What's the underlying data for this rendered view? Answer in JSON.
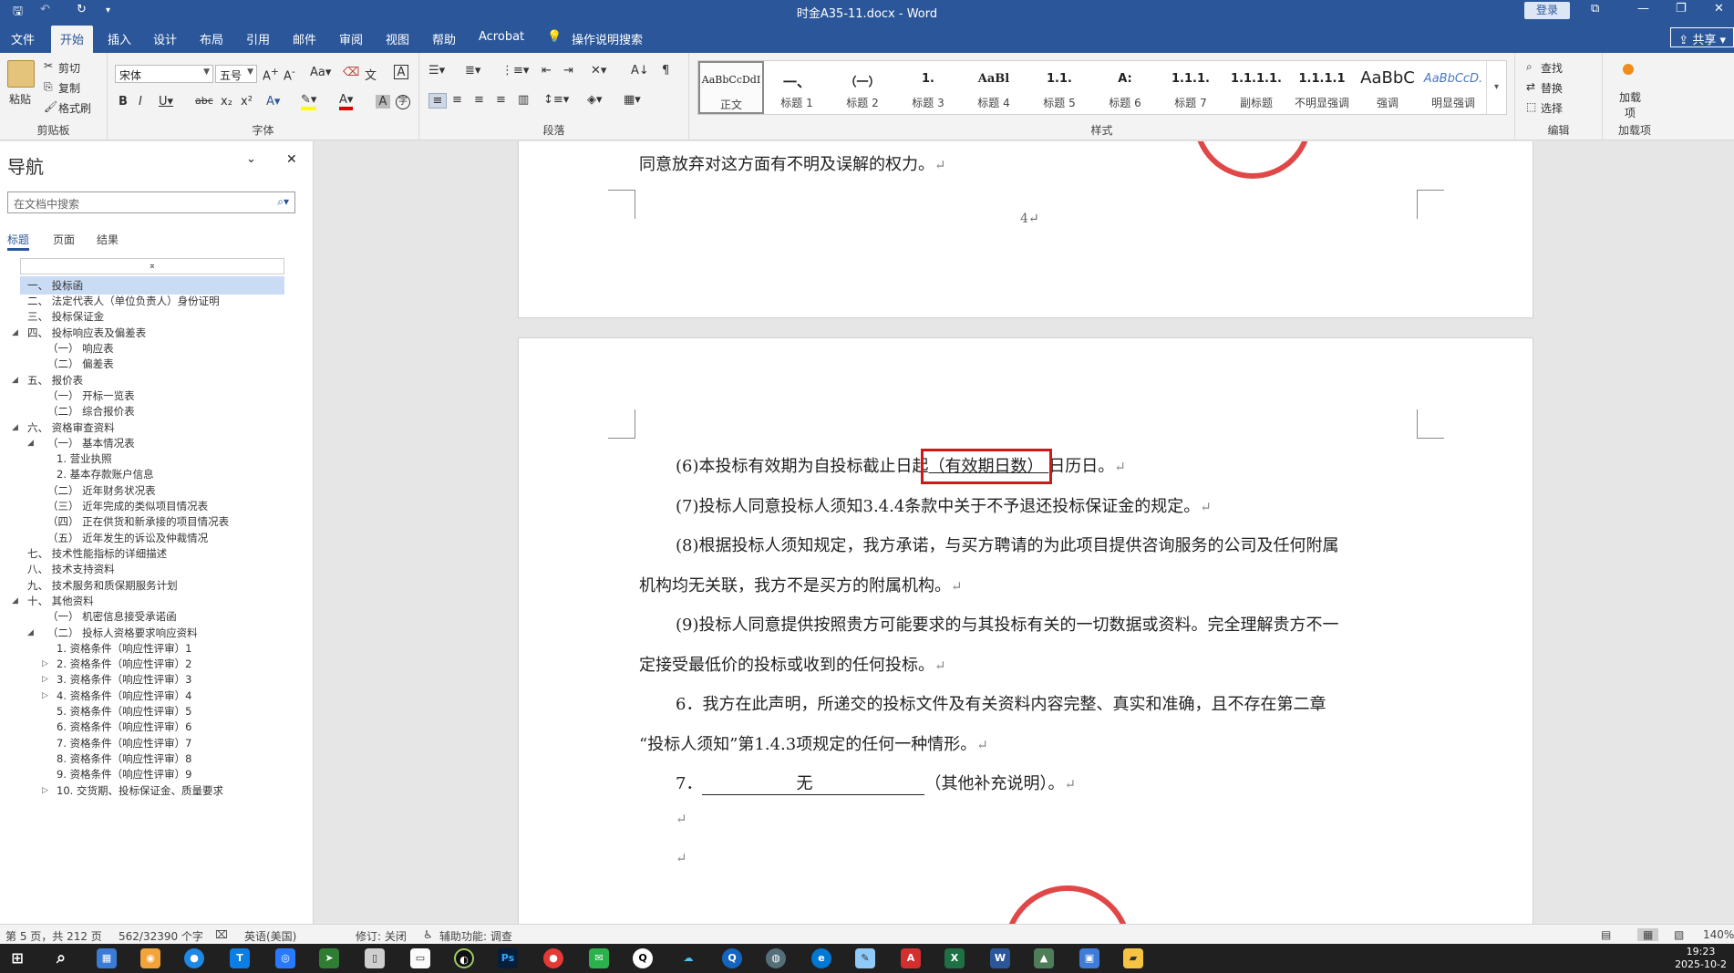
{
  "titlebar": {
    "save_icon": "save-icon",
    "doc_title": "时金A35-11.docx - Word",
    "login": "登录"
  },
  "tabs": [
    "文件",
    "开始",
    "插入",
    "设计",
    "布局",
    "引用",
    "邮件",
    "审阅",
    "视图",
    "帮助",
    "Acrobat"
  ],
  "tell_me": "操作说明搜索",
  "share": "共享",
  "ribbon": {
    "clipboard": {
      "paste": "粘贴",
      "cut": "剪切",
      "copy": "复制",
      "format_painter": "格式刷",
      "label": "剪贴板"
    },
    "font": {
      "name": "宋体",
      "size": "五号",
      "label": "字体"
    },
    "paragraph": {
      "label": "段落"
    },
    "styles": {
      "label": "样式",
      "items": [
        {
          "preview": "AaBbCcDdI",
          "name": "正文"
        },
        {
          "preview": "一、",
          "name": "标题 1"
        },
        {
          "preview": "（一）",
          "name": "标题 2"
        },
        {
          "preview": "1.",
          "name": "标题 3"
        },
        {
          "preview": "AaBl",
          "name": "标题 4"
        },
        {
          "preview": "1.1.",
          "name": "标题 5"
        },
        {
          "preview": "A:",
          "name": "标题 6"
        },
        {
          "preview": "1.1.1.",
          "name": "标题 7"
        },
        {
          "preview": "1.1.1.1.",
          "name": "副标题"
        },
        {
          "preview": "1.1.1.1",
          "name": "不明显强调"
        },
        {
          "preview": "AaBbC",
          "name": "强调"
        },
        {
          "preview": "AaBbCcD.",
          "name": "明显强调"
        }
      ]
    },
    "editing": {
      "find": "查找",
      "replace": "替换",
      "select": "选择",
      "label": "编辑"
    },
    "addins": {
      "btn": "加载项",
      "label": "加载项"
    }
  },
  "nav": {
    "title": "导航",
    "search_placeholder": "在文档中搜索",
    "tabs": [
      "标题",
      "页面",
      "结果"
    ],
    "items": [
      "一、 投标函",
      "二、 法定代表人（单位负责人）身份证明",
      "三、 投标保证金",
      "四、 投标响应表及偏差表",
      "（一） 响应表",
      "（二） 偏差表",
      "五、 报价表",
      "（一） 开标一览表",
      "（二） 综合报价表",
      "六、 资格审查资料",
      "（一） 基本情况表",
      "1. 营业执照",
      "2. 基本存款账户信息",
      "（二） 近年财务状况表",
      "（三） 近年完成的类似项目情况表",
      "（四） 正在供货和新承接的项目情况表",
      "（五） 近年发生的诉讼及仲裁情况",
      "七、 技术性能指标的详细描述",
      "八、 技术支持资料",
      "九、 技术服务和质保期服务计划",
      "十、 其他资料",
      "（一） 机密信息接受承诺函",
      "（二） 投标人资格要求响应资料",
      "1. 资格条件（响应性评审）1",
      "2. 资格条件（响应性评审）2",
      "3. 资格条件（响应性评审）3",
      "4. 资格条件（响应性评审）4",
      "5. 资格条件（响应性评审）5",
      "6. 资格条件（响应性评审）6",
      "7. 资格条件（响应性评审）7",
      "8. 资格条件（响应性评审）8",
      "9. 资格条件（响应性评审）9",
      "10. 交货期、投标保证金、质量要求"
    ]
  },
  "doc": {
    "top_line": "同意放弃对这方面有不明及误解的权力。",
    "page_number": "4",
    "p6a": "(6)本投标有效期为自投标截止日起",
    "p6b": "（有效期日数）",
    "p6c": "日历日。",
    "p7": "(7)投标人同意投标人须知3.4.4条款中关于不予退还投标保证金的规定。",
    "p8a": "(8)根据投标人须知规定，我方承诺，与买方聘请的为此项目提供咨询服务的公司及任何附属",
    "p8b": "机构均无关联，我方不是买方的附属机构。",
    "p9a": "(9)投标人同意提供按照贵方可能要求的与其投标有关的一切数据或资料。完全理解贵方不一",
    "p9b": "定接受最低价的投标或收到的任何投标。",
    "s6a": "6．我方在此声明，所递交的投标文件及有关资料内容完整、真实和准确，且不存在第二章",
    "s6b": "“投标人须知”第1.4.3项规定的任何一种情形。",
    "s7a": "7．",
    "s7b": "无",
    "s7c": "（其他补充说明）。",
    "mark": "↵"
  },
  "status": {
    "page": "第 5 页，共 212 页",
    "words": "562/32390 个字",
    "lang": "英语(美国)",
    "track": "修订: 关闭",
    "access": "辅助功能: 调查",
    "zoom": "140%"
  },
  "taskbar": {
    "time": "19:23",
    "date": "2025-10-2"
  }
}
